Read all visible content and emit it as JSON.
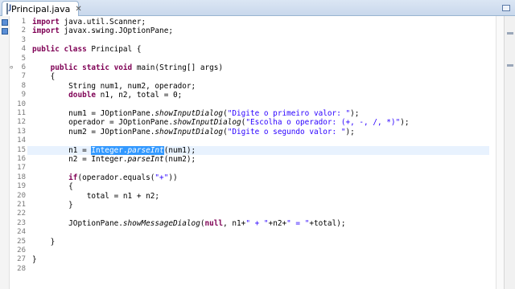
{
  "tab": {
    "title": "Principal.java",
    "close": "✕"
  },
  "code_lines": [
    {
      "n": "1",
      "tokens": [
        {
          "t": "import ",
          "c": "kw"
        },
        {
          "t": "java.util.Scanner;",
          "c": ""
        }
      ]
    },
    {
      "n": "2",
      "tokens": [
        {
          "t": "import ",
          "c": "kw"
        },
        {
          "t": "javax.swing.JOptionPane;",
          "c": ""
        }
      ]
    },
    {
      "n": "3",
      "tokens": []
    },
    {
      "n": "4",
      "tokens": [
        {
          "t": "public ",
          "c": "kw"
        },
        {
          "t": "class ",
          "c": "kw"
        },
        {
          "t": "Principal {",
          "c": ""
        }
      ]
    },
    {
      "n": "5",
      "tokens": []
    },
    {
      "n": "6",
      "tokens": [
        {
          "t": "    "
        },
        {
          "t": "public ",
          "c": "kw"
        },
        {
          "t": "static ",
          "c": "kw"
        },
        {
          "t": "void ",
          "c": "kw"
        },
        {
          "t": "main(String[] args)",
          "c": ""
        }
      ]
    },
    {
      "n": "7",
      "tokens": [
        {
          "t": "    {",
          "c": ""
        }
      ]
    },
    {
      "n": "8",
      "tokens": [
        {
          "t": "        String num1, num2, operador;",
          "c": ""
        }
      ]
    },
    {
      "n": "9",
      "tokens": [
        {
          "t": "        "
        },
        {
          "t": "double ",
          "c": "kw"
        },
        {
          "t": "n1, n2, total = 0;",
          "c": ""
        }
      ]
    },
    {
      "n": "10",
      "tokens": []
    },
    {
      "n": "11",
      "tokens": [
        {
          "t": "        num1 = JOptionPane.",
          "c": ""
        },
        {
          "t": "showInputDialog",
          "c": "it"
        },
        {
          "t": "(",
          "c": ""
        },
        {
          "t": "\"Digite o primeiro valor: \"",
          "c": "str"
        },
        {
          "t": ");",
          "c": ""
        }
      ]
    },
    {
      "n": "12",
      "tokens": [
        {
          "t": "        operador = JOptionPane.",
          "c": ""
        },
        {
          "t": "showInputDialog",
          "c": "it"
        },
        {
          "t": "(",
          "c": ""
        },
        {
          "t": "\"Escolha o operador: (+, -, /, *)\"",
          "c": "str"
        },
        {
          "t": ");",
          "c": ""
        }
      ]
    },
    {
      "n": "13",
      "tokens": [
        {
          "t": "        num2 = JOptionPane.",
          "c": ""
        },
        {
          "t": "showInputDialog",
          "c": "it"
        },
        {
          "t": "(",
          "c": ""
        },
        {
          "t": "\"Digite o segundo valor: \"",
          "c": "str"
        },
        {
          "t": ");",
          "c": ""
        }
      ]
    },
    {
      "n": "14",
      "tokens": []
    },
    {
      "n": "15",
      "tokens": [
        {
          "t": "        n1 = ",
          "c": ""
        },
        {
          "t": "Integer.",
          "c": "sel"
        },
        {
          "t": "parseInt",
          "c": "sel it"
        },
        {
          "t": "(num1);",
          "c": ""
        }
      ]
    },
    {
      "n": "16",
      "tokens": [
        {
          "t": "        n2 = Integer.",
          "c": ""
        },
        {
          "t": "parseInt",
          "c": "it"
        },
        {
          "t": "(num2);",
          "c": ""
        }
      ]
    },
    {
      "n": "17",
      "tokens": []
    },
    {
      "n": "18",
      "tokens": [
        {
          "t": "        "
        },
        {
          "t": "if",
          "c": "kw"
        },
        {
          "t": "(operador.equals(",
          "c": ""
        },
        {
          "t": "\"+\"",
          "c": "str"
        },
        {
          "t": "))",
          "c": ""
        }
      ]
    },
    {
      "n": "19",
      "tokens": [
        {
          "t": "        {",
          "c": ""
        }
      ]
    },
    {
      "n": "20",
      "tokens": [
        {
          "t": "            total = n1 + n2;",
          "c": ""
        }
      ]
    },
    {
      "n": "21",
      "tokens": [
        {
          "t": "        }",
          "c": ""
        }
      ]
    },
    {
      "n": "22",
      "tokens": []
    },
    {
      "n": "23",
      "tokens": [
        {
          "t": "        JOptionPane.",
          "c": ""
        },
        {
          "t": "showMessageDialog",
          "c": "it"
        },
        {
          "t": "(",
          "c": ""
        },
        {
          "t": "null",
          "c": "kw"
        },
        {
          "t": ", n1+",
          "c": ""
        },
        {
          "t": "\" + \"",
          "c": "str"
        },
        {
          "t": "+n2+",
          "c": ""
        },
        {
          "t": "\" = \"",
          "c": "str"
        },
        {
          "t": "+total);",
          "c": ""
        }
      ]
    },
    {
      "n": "24",
      "tokens": []
    },
    {
      "n": "25",
      "tokens": [
        {
          "t": "    }",
          "c": ""
        }
      ]
    },
    {
      "n": "26",
      "tokens": []
    },
    {
      "n": "27",
      "tokens": [
        {
          "t": "}",
          "c": ""
        }
      ]
    },
    {
      "n": "28",
      "tokens": []
    }
  ],
  "fold_markers": {
    "6": "⊖"
  },
  "current_line": "15",
  "colors": {
    "keyword": "#7f0055",
    "string": "#2a00ff",
    "selection": "#3399ff",
    "current_line": "#e8f2fe"
  },
  "icons": {
    "tab_file": "java-file-icon",
    "tab_close": "close-icon",
    "minimize": "minimize-icon",
    "fold": "fold-minus-icon",
    "warning": "warning-marker-icon"
  }
}
